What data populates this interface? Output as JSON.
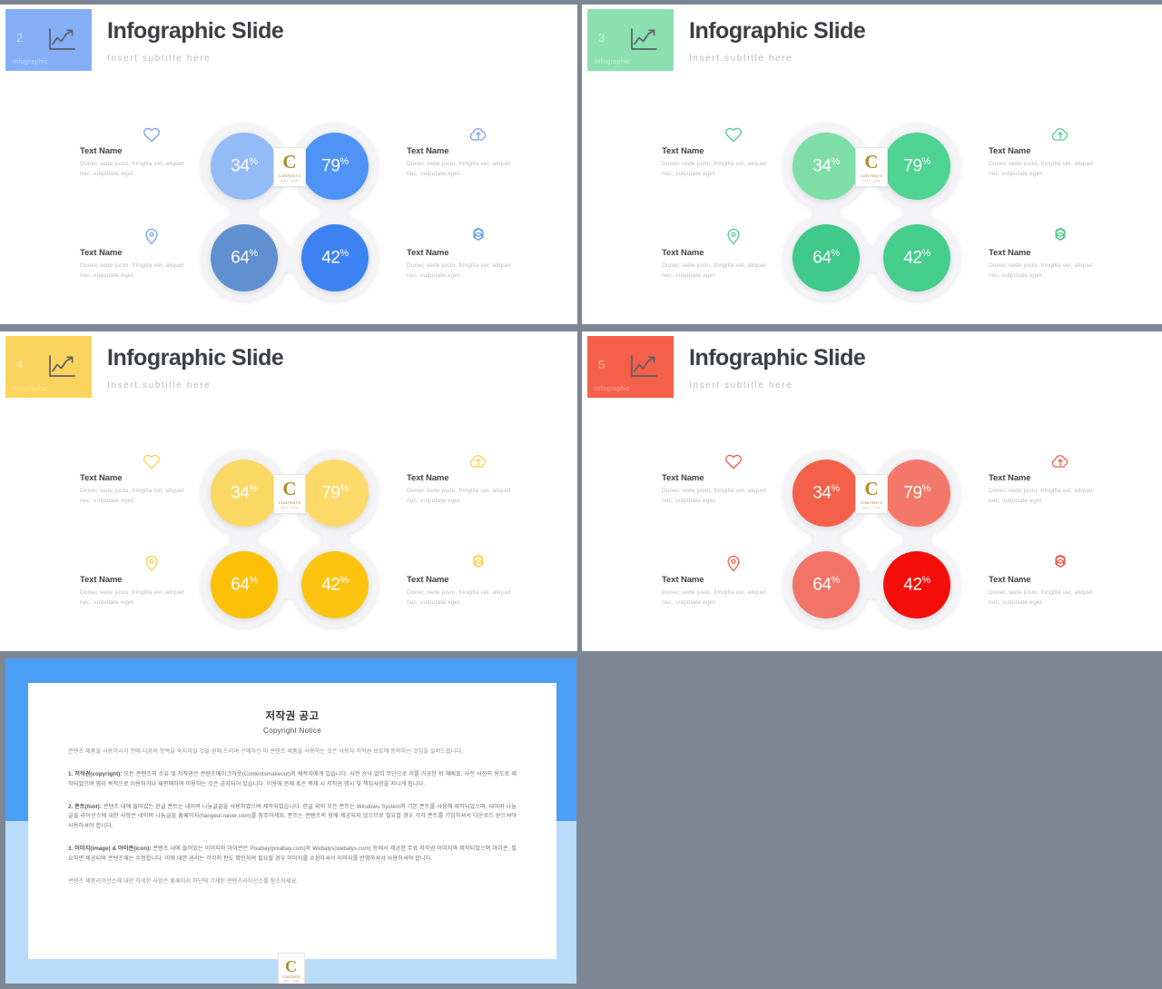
{
  "slides": [
    {
      "id": "slide-blue",
      "number": "2",
      "badge_label": "Infographic",
      "badge_color": "#84aef6",
      "title": "Infographic Slide",
      "subtitle": "Insert  subtitle  here",
      "circles": [
        {
          "pos": "top-left",
          "value": "34",
          "pct": "%",
          "color": "#93bbf5"
        },
        {
          "pos": "top-right",
          "value": "79",
          "pct": "%",
          "color": "#4f93f7"
        },
        {
          "pos": "bottom-left",
          "value": "64",
          "pct": "%",
          "color": "#6090cf"
        },
        {
          "pos": "bottom-right",
          "value": "42",
          "pct": "%",
          "color": "#3d82f2"
        }
      ],
      "icon_color": "#6fa0e8",
      "texts": [
        {
          "pos": "left-top",
          "icon": "heart-icon",
          "name": "Text Name",
          "body": "Donec sede justo, fringilla  vel, aliquet nec, vulputate eget."
        },
        {
          "pos": "left-bottom",
          "icon": "map-pin-icon",
          "name": "Text Name",
          "body": "Donec sede justo, fringilla  vel, aliquet nec, vulputate eget."
        },
        {
          "pos": "right-top",
          "icon": "cloud-upload-icon",
          "name": "Text Name",
          "body": "Donec sede justo, fringilla  vel, aliquet nec, vulputate eget."
        },
        {
          "pos": "right-bottom",
          "icon": "gear-flower-icon",
          "name": "Text Name",
          "body": "Donec sede justo, fringilla  vel, aliquet nec, vulputate eget."
        }
      ]
    },
    {
      "id": "slide-green",
      "number": "3",
      "badge_label": "Infographic",
      "badge_color": "#8ce0b0",
      "title": "Infographic Slide",
      "subtitle": "Insert  subtitle  here",
      "circles": [
        {
          "pos": "top-left",
          "value": "34",
          "pct": "%",
          "color": "#7fdda8"
        },
        {
          "pos": "top-right",
          "value": "79",
          "pct": "%",
          "color": "#4fd392"
        },
        {
          "pos": "bottom-left",
          "value": "64",
          "pct": "%",
          "color": "#3fc98a"
        },
        {
          "pos": "bottom-right",
          "value": "42",
          "pct": "%",
          "color": "#45cd8c"
        }
      ],
      "icon_color": "#55c98d",
      "texts": [
        {
          "pos": "left-top",
          "icon": "heart-icon",
          "name": "Text Name",
          "body": "Donec sede justo, fringilla  vel, aliquet nec, vulputate eget."
        },
        {
          "pos": "left-bottom",
          "icon": "map-pin-icon",
          "name": "Text Name",
          "body": "Donec sede justo, fringilla  vel, aliquet nec, vulputate eget."
        },
        {
          "pos": "right-top",
          "icon": "cloud-upload-icon",
          "name": "Text Name",
          "body": "Donec sede justo, fringilla  vel, aliquet nec, vulputate eget."
        },
        {
          "pos": "right-bottom",
          "icon": "gear-flower-icon",
          "name": "Text Name",
          "body": "Donec sede justo, fringilla  vel, aliquet nec, vulputate eget."
        }
      ]
    },
    {
      "id": "slide-yellow",
      "number": "4",
      "badge_label": "Infographic",
      "badge_color": "#fbd35f",
      "title": "Infographic Slide",
      "subtitle": "Insert  subtitle  here",
      "circles": [
        {
          "pos": "top-left",
          "value": "34",
          "pct": "%",
          "color": "#fbd863"
        },
        {
          "pos": "top-right",
          "value": "79",
          "pct": "%",
          "color": "#fcd968"
        },
        {
          "pos": "bottom-left",
          "value": "64",
          "pct": "%",
          "color": "#fcc107"
        },
        {
          "pos": "bottom-right",
          "value": "42",
          "pct": "%",
          "color": "#fcc40f"
        }
      ],
      "icon_color": "#fbcf4a",
      "texts": [
        {
          "pos": "left-top",
          "icon": "heart-icon",
          "name": "Text Name",
          "body": "Donec sede justo, fringilla  vel, aliquet nec, vulputate eget."
        },
        {
          "pos": "left-bottom",
          "icon": "map-pin-icon",
          "name": "Text Name",
          "body": "Donec sede justo, fringilla  vel, aliquet nec, vulputate eget."
        },
        {
          "pos": "right-top",
          "icon": "cloud-upload-icon",
          "name": "Text Name",
          "body": "Donec sede justo, fringilla  vel, aliquet nec, vulputate eget."
        },
        {
          "pos": "right-bottom",
          "icon": "gear-flower-icon",
          "name": "Text Name",
          "body": "Donec sede justo, fringilla  vel, aliquet nec, vulputate eget."
        }
      ]
    },
    {
      "id": "slide-red",
      "number": "5",
      "badge_label": "Infographic",
      "badge_color": "#f4604a",
      "title": "Infographic Slide",
      "subtitle": "Insert  subtitle  here",
      "circles": [
        {
          "pos": "top-left",
          "value": "34",
          "pct": "%",
          "color": "#f4614a"
        },
        {
          "pos": "top-right",
          "value": "79",
          "pct": "%",
          "color": "#f4786a"
        },
        {
          "pos": "bottom-left",
          "value": "64",
          "pct": "%",
          "color": "#f27466"
        },
        {
          "pos": "bottom-right",
          "value": "42",
          "pct": "%",
          "color": "#f40d09"
        }
      ],
      "icon_color": "#f05a4a",
      "texts": [
        {
          "pos": "left-top",
          "icon": "heart-icon",
          "name": "Text Name",
          "body": "Donec sede justo, fringilla  vel, aliquet nec, vulputate eget."
        },
        {
          "pos": "left-bottom",
          "icon": "map-pin-icon",
          "name": "Text Name",
          "body": "Donec sede justo, fringilla  vel, aliquet nec, vulputate eget."
        },
        {
          "pos": "right-top",
          "icon": "cloud-upload-icon",
          "name": "Text Name",
          "body": "Donec sede justo, fringilla  vel, aliquet nec, vulputate eget."
        },
        {
          "pos": "right-bottom",
          "icon": "gear-flower-icon",
          "name": "Text Name",
          "body": "Donec sede justo, fringilla  vel, aliquet nec, vulputate eget."
        }
      ]
    }
  ],
  "center_logo": {
    "letter": "C",
    "line1": "CONTENTS",
    "line2": "MALL . COM"
  },
  "copyright_slide": {
    "id": "slide-copyright",
    "title_ko": "저작권 공고",
    "title_en": "Copyright Notice",
    "border_top_color": "#4a9ef5",
    "border_bottom_color": "#b9dcfb",
    "intro": "콘텐츠 제품을 사용하시기 전에 다음의 항목을 숙지하실 것을 권해 드리며 구매하신 이 콘텐츠 제품을 사용하는 것은 사용자 저작권 보호에 동의하신 것임을 알려드립니다.",
    "sections": [
      {
        "label": "1. 저작권(copyright):",
        "body": " 모든 콘텐츠의 소유 및 저작권은 콘텐츠메이크아웃(Contentsmakeout)의 제작자에게 있습니다. 사전 승낙 없이 무단으로 이를 가공한 뒤 재배포, 사전 사전의 용도로 제작되었으며 영리 목적으로 이용하거나 재판매하여 이용하는 것은 금지되어 있습니다. 이용에 문제 혹은 복제 시 저작권 명시 및 책임사항을 지니게 됩니다."
      },
      {
        "label": "2. 폰트(font):",
        "body": " 콘텐츠 내에 들어있는 한글 폰트는 네이버 나눔글꼴을 사용하였으며 제작되었습니다. 한글 외의 모든 폰트는 Windows System의 기본 폰트를 사용해 제작되었으며, 네이버 나눔글꼴 라이선스에 대한 사항은 네이버 나눔글꼴 홈페이지(hangeul.naver.com)를 참조하세요. 폰트는 콘텐츠의 함께 제공되지 않으므로 필요할 경우 각각 폰트를 기입하셔서 다운로드 받으셔야 사용하셔야 합니다."
      },
      {
        "label": "3. 이미지(image) & 아이콘(icon):",
        "body": " 콘텐츠 내에 들어있는 이미지와 아이콘은 Pixabay(pixabay.com)와 Webalys(webalys.com) 등에서 제공한 무료 저작권 이미지와 제작되었으며 아이콘, 필요하면 제공되며 콘텐츠에는 수정합니다. 이에 대한 권리는 각각의 판도 확인하여 필요할 경우 이미지를 수정하셔서 이미지를 반영하셔서 사용하셔야 합니다."
      }
    ],
    "footer": "콘텐츠 제품라이선스에 대한 자세한 사항은 홈페이지 하단에 기재된 콘텐츠라이선스를 참조하세요."
  }
}
